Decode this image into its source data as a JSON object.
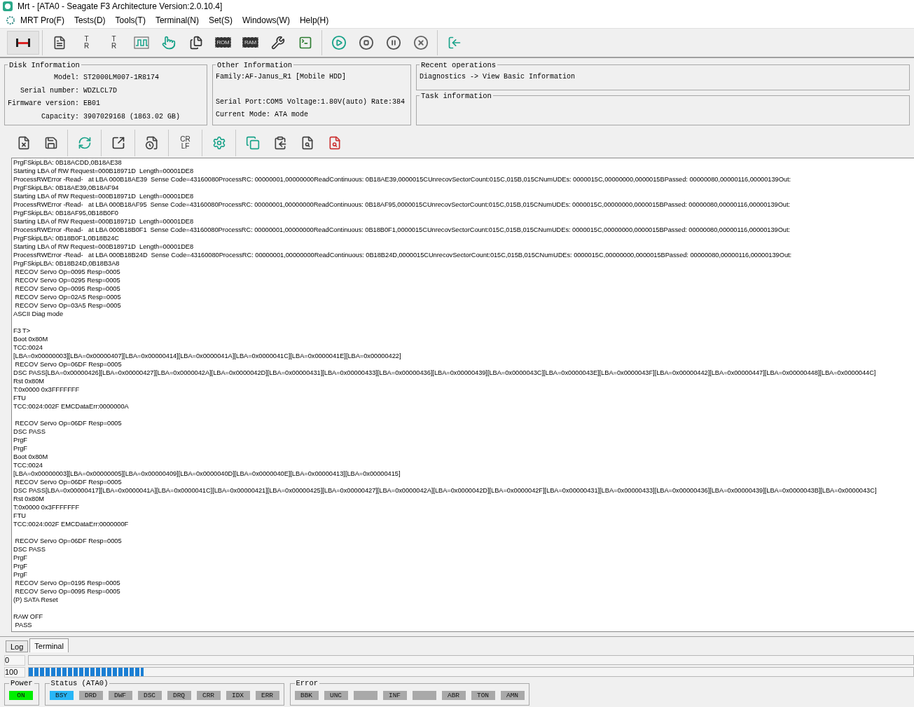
{
  "window": {
    "title": "Mrt - [ATA0 - Seagate F3 Architecture Version:2.0.10.4]"
  },
  "menu": [
    "MRT Pro(F)",
    "Tests(D)",
    "Tools(T)",
    "Terminal(N)",
    "Set(S)",
    "Windows(W)",
    "Help(H)"
  ],
  "toolbar": [
    [
      {
        "kind": "connector",
        "selected": true
      }
    ],
    [
      {
        "kind": "report",
        "selected": false
      },
      {
        "kind": "tr",
        "label_top": "T",
        "label_bottom": "R",
        "selected": false
      },
      {
        "kind": "tr-clear",
        "label_top": "T",
        "label_bottom": "R",
        "selected": false
      },
      {
        "kind": "wave",
        "selected": false
      },
      {
        "kind": "touch",
        "selected": false
      },
      {
        "kind": "copy-rotate",
        "selected": false
      },
      {
        "kind": "chip",
        "label": "ROM",
        "selected": false
      },
      {
        "kind": "chip",
        "label": "RAM",
        "selected": false
      },
      {
        "kind": "tools",
        "selected": false
      },
      {
        "kind": "terminal",
        "selected": false
      }
    ],
    [
      {
        "kind": "play",
        "selected": false
      },
      {
        "kind": "stop",
        "selected": false
      },
      {
        "kind": "pause",
        "selected": false
      },
      {
        "kind": "cancel",
        "selected": false
      }
    ],
    [
      {
        "kind": "exit",
        "selected": false
      }
    ]
  ],
  "disk_information": {
    "title": "Disk Information",
    "fields": [
      {
        "label": "Model:",
        "value": "ST2000LM007-1R8174"
      },
      {
        "label": "Serial number:",
        "value": "WDZLCL7D"
      },
      {
        "label": "Firmware version:",
        "value": "EB01"
      },
      {
        "label": "Capacity:",
        "value": "3907029168 (1863.02 GB)"
      }
    ]
  },
  "other_information": {
    "title": "Other Information",
    "paragraphs": [
      [
        "Family:AF-Janus_R1 [Mobile HDD]"
      ],
      [
        "Serial Port:COM5 Voltage:1.80V(auto) Rate:384",
        "Current Mode: ATA mode"
      ]
    ]
  },
  "recent_operations": {
    "title": "Recent operations",
    "text": "Diagnostics -> View Basic Information"
  },
  "task_information": {
    "title": "Task information"
  },
  "log_toolbar": [
    [
      {
        "kind": "clear-log"
      },
      {
        "kind": "save"
      }
    ],
    [
      {
        "kind": "save-refresh"
      }
    ],
    [
      {
        "kind": "export"
      }
    ],
    [
      {
        "kind": "log-pause"
      }
    ],
    [
      {
        "kind": "crlf",
        "label_top": "CR",
        "label_bottom": "LF"
      }
    ],
    [
      {
        "kind": "settings"
      }
    ],
    [
      {
        "kind": "copy"
      },
      {
        "kind": "paste"
      },
      {
        "kind": "find"
      },
      {
        "kind": "find-down"
      }
    ]
  ],
  "log": [
    [
      "PrgFSkipLBA: 0B18ACDD,0B18AE38",
      "Starting LBA of RW Request=000B18971D  Length=00001DE8",
      "ProcessRWError -Read-   at LBA 000B18AE39  Sense Code=43160080ProcessRC: 00000001,00000000ReadContinuous: 0B18AE39,0000015CUnrecovSectorCount:015C,015B,015CNumUDEs: 0000015C,00000000,0000015BPassed: 00000080,00000116,00000139Out:",
      "PrgFSkipLBA: 0B18AE39,0B18AF94",
      "Starting LBA of RW Request=000B18971D  Length=00001DE8",
      "ProcessRWError -Read-   at LBA 000B18AF95  Sense Code=43160080ProcessRC: 00000001,00000000ReadContinuous: 0B18AF95,0000015CUnrecovSectorCount:015C,015B,015CNumUDEs: 0000015C,00000000,0000015BPassed: 00000080,00000116,00000139Out:",
      "PrgFSkipLBA: 0B18AF95,0B18B0F0",
      "Starting LBA of RW Request=000B18971D  Length=00001DE8",
      "ProcessRWError -Read-   at LBA 000B18B0F1  Sense Code=43160080ProcessRC: 00000001,00000000ReadContinuous: 0B18B0F1,0000015CUnrecovSectorCount:015C,015B,015CNumUDEs: 0000015C,00000000,0000015BPassed: 00000080,00000116,00000139Out:",
      "PrgFSkipLBA: 0B18B0F1,0B18B24C",
      "Starting LBA of RW Request=000B18971D  Length=00001DE8",
      "ProcessRWError -Read-   at LBA 000B18B24D  Sense Code=43160080ProcessRC: 00000001,00000000ReadContinuous: 0B18B24D,0000015CUnrecovSectorCount:015C,015B,015CNumUDEs: 0000015C,00000000,0000015BPassed: 00000080,00000116,00000139Out:",
      "PrgFSkipLBA: 0B18B24D,0B18B3A8",
      " RECOV Servo Op=0095 Resp=0005",
      " RECOV Servo Op=0295 Resp=0005",
      " RECOV Servo Op=0095 Resp=0005",
      " RECOV Servo Op=02A5 Resp=0005",
      " RECOV Servo Op=03A5 Resp=0005",
      "ASCII Diag mode"
    ],
    [
      "F3 T>",
      "Boot 0x80M",
      "TCC:0024",
      "[LBA=0x00000003][LBA=0x00000407][LBA=0x00000414][LBA=0x0000041A][LBA=0x0000041C][LBA=0x0000041E][LBA=0x00000422]",
      " RECOV Servo Op=06DF Resp=0005",
      "DSC PASS[LBA=0x00000426][LBA=0x00000427][LBA=0x0000042A][LBA=0x0000042D][LBA=0x00000431][LBA=0x00000433][LBA=0x00000436][LBA=0x00000439][LBA=0x0000043C][LBA=0x0000043E][LBA=0x0000043F][LBA=0x00000442][LBA=0x00000447][LBA=0x00000448][LBA=0x0000044C]",
      "Rst 0x80M",
      "T:0x0000 0x3FFFFFFF",
      "FTU",
      "TCC:0024:002F EMCDataErr:0000000A"
    ],
    [
      " RECOV Servo Op=06DF Resp=0005",
      "DSC PASS",
      "PrgF",
      "PrgF",
      "Boot 0x80M",
      "TCC:0024",
      "[LBA=0x00000003][LBA=0x00000005][LBA=0x00000409][LBA=0x0000040D][LBA=0x0000040E][LBA=0x00000413][LBA=0x00000415]",
      " RECOV Servo Op=06DF Resp=0005",
      "DSC PASS[LBA=0x00000417][LBA=0x0000041A][LBA=0x0000041C][LBA=0x00000421][LBA=0x00000425][LBA=0x00000427][LBA=0x0000042A][LBA=0x0000042D][LBA=0x0000042F][LBA=0x00000431][LBA=0x00000433][LBA=0x00000436][LBA=0x00000439][LBA=0x0000043B][LBA=0x0000043C]",
      "Rst 0x80M",
      "T:0x0000 0x3FFFFFFF",
      "FTU",
      "TCC:0024:002F EMCDataErr:0000000F"
    ],
    [
      " RECOV Servo Op=06DF Resp=0005",
      "DSC PASS",
      "PrgF",
      "PrgF",
      "PrgF",
      " RECOV Servo Op=0195 Resp=0005",
      " RECOV Servo Op=0095 Resp=0005",
      "(P) SATA Reset"
    ],
    [
      "RAW OFF",
      " PASS"
    ]
  ],
  "tabs": [
    {
      "label": "Log",
      "selected": false
    },
    {
      "label": "Terminal",
      "selected": true
    }
  ],
  "progress": [
    {
      "value": "0",
      "level": 0
    },
    {
      "value": "100",
      "level": 0.13
    }
  ],
  "indicators": [
    {
      "title": "Power",
      "leds": [
        {
          "label": "ON",
          "color": "#00ee00"
        }
      ]
    },
    {
      "title": "Status (ATA0)",
      "leds": [
        {
          "label": "BSY",
          "color": "#29b6f6"
        },
        {
          "label": "DRD",
          "color": "#a9a9a9"
        },
        {
          "label": "DWF",
          "color": "#a9a9a9"
        },
        {
          "label": "DSC",
          "color": "#a9a9a9"
        },
        {
          "label": "DRQ",
          "color": "#a9a9a9"
        },
        {
          "label": "CRR",
          "color": "#a9a9a9"
        },
        {
          "label": "IDX",
          "color": "#a9a9a9"
        },
        {
          "label": "ERR",
          "color": "#a9a9a9"
        }
      ]
    },
    {
      "title": "Error",
      "leds": [
        {
          "label": "BBK",
          "color": "#a9a9a9"
        },
        {
          "label": "UNC",
          "color": "#a9a9a9"
        },
        {
          "color": "#a9a9a9"
        },
        {
          "label": "INF",
          "color": "#a9a9a9"
        },
        {
          "color": "#a9a9a9"
        },
        {
          "label": "ABR",
          "color": "#a9a9a9"
        },
        {
          "label": "TON",
          "color": "#a9a9a9"
        },
        {
          "label": "AMN",
          "color": "#a9a9a9"
        }
      ]
    }
  ]
}
